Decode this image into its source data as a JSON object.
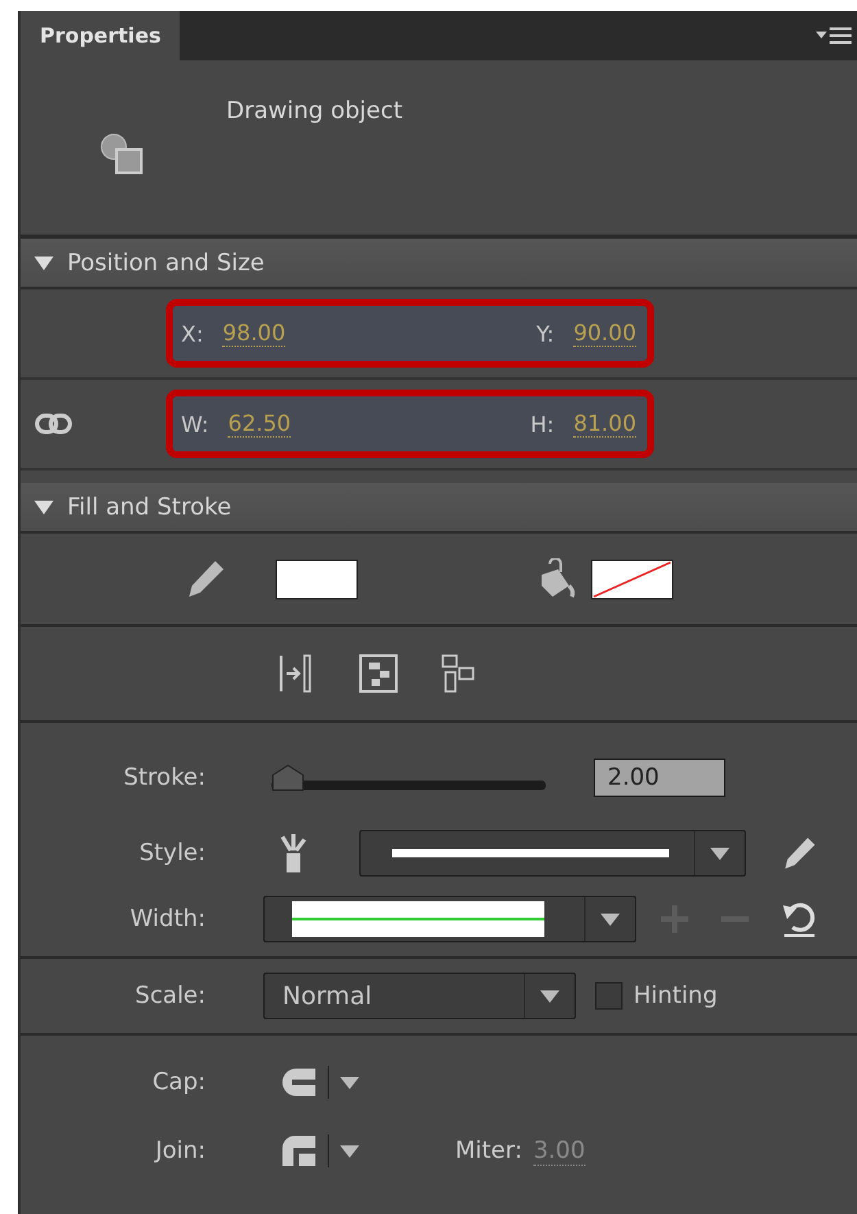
{
  "tab": {
    "label": "Properties",
    "selected": true
  },
  "object": {
    "label": "Drawing object"
  },
  "position_and_size": {
    "title": "Position and Size",
    "expanded": true,
    "rows": [
      {
        "highlighted": true,
        "fields": [
          {
            "label": "X:",
            "value": "98.00"
          },
          {
            "label": "Y:",
            "value": "90.00"
          }
        ]
      },
      {
        "highlighted": true,
        "fields": [
          {
            "label": "W:",
            "value": "62.50"
          },
          {
            "label": "H:",
            "value": "81.00"
          }
        ]
      }
    ]
  },
  "fill_and_stroke": {
    "title": "Fill and Stroke",
    "expanded": true,
    "stroke": {
      "label": "Stroke:",
      "level": 0.0,
      "value": "2.00"
    },
    "style": {
      "label": "Style:"
    },
    "width": {
      "label": "Width:"
    },
    "scale": {
      "label": "Scale:",
      "value": "Normal"
    },
    "hinting": {
      "label": "Hinting",
      "checked": false
    },
    "cap": {
      "label": "Cap:"
    },
    "join": {
      "label": "Join:"
    },
    "miter": {
      "label": "Miter:",
      "value": "3.00",
      "disabled": true
    }
  }
}
